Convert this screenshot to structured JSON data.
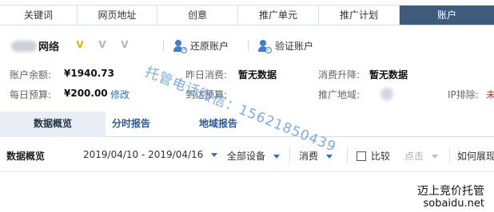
{
  "top_tabs": [
    {
      "label": "关键词",
      "active": false
    },
    {
      "label": "网页地址",
      "active": false
    },
    {
      "label": "创意",
      "active": false
    },
    {
      "label": "推广单元",
      "active": false
    },
    {
      "label": "推广计划",
      "active": false
    },
    {
      "label": "账户",
      "active": true
    }
  ],
  "account": {
    "name": "网络",
    "badges": [
      "V",
      "V",
      "V"
    ],
    "actions": {
      "restore": "还原账户",
      "verify": "验证账户"
    }
  },
  "info": {
    "balance_label": "账户余额:",
    "balance_value": "¥1940.73",
    "yesterday_label": "昨日消费:",
    "yesterday_value": "暂无数据",
    "rise_label": "消费升降:",
    "rise_value": "暂无数据",
    "budget_label": "每日预算:",
    "budget_value": "¥200.00",
    "budget_edit": "修改",
    "reach_label": "到达预算:",
    "region_label": "推广地域:",
    "ip_label": "IP排除:",
    "ip_value": "未"
  },
  "sub_tabs": [
    {
      "label": "数据概览",
      "active": true
    },
    {
      "label": "分时报告",
      "active": false
    },
    {
      "label": "地域报告",
      "active": false
    }
  ],
  "filters": {
    "section_title": "数据概览",
    "date_range": "2019/04/10 - 2019/04/16",
    "device": "全部设备",
    "metric": "消费",
    "compare": "比较",
    "point": "点击",
    "howto": "如何展现"
  },
  "watermark": "托管电话微信：15621850439",
  "brand": {
    "line1": "迈上竞价托管",
    "line2": "sobaidu.net"
  },
  "colors": {
    "active_tab_bg": "#3e5b7e",
    "link": "#2a6fd6",
    "badge_gold": "#e8b400",
    "badge_grey": "#b5b5b5"
  }
}
